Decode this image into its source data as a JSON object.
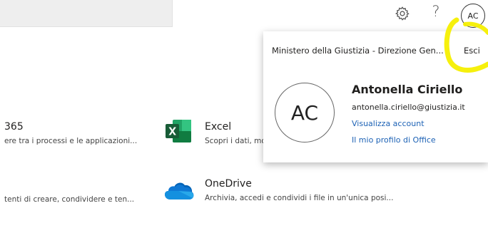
{
  "topbar": {
    "help_glyph": "?",
    "user_initials": "AC"
  },
  "apps": [
    {
      "name": "365",
      "description": "ere tra i processi e le applicazioni..."
    },
    {
      "name": "",
      "description": "tenti di creare, condividere e ten..."
    },
    {
      "name": "Excel",
      "description": "Scopri i dati, mo"
    },
    {
      "name": "OneDrive",
      "description": "Archivia, accedi e condividi i file in un'unica posi..."
    }
  ],
  "account_panel": {
    "organization": "Ministero della Giustizia - Direzione Gen...",
    "sign_out_label": "Esci",
    "initials": "AC",
    "user_name": "Antonella Ciriello",
    "user_email": "antonella.ciriello@giustizia.it",
    "view_account_label": "Visualizza account",
    "office_profile_label": "Il mio profilo di Office"
  },
  "icons": {
    "settings": "gear-icon",
    "excel": "excel-icon",
    "onedrive": "onedrive-icon"
  },
  "colors": {
    "link": "#1d62b5",
    "excel_green": "#1d6f42",
    "onedrive_blue": "#0364b8",
    "highlighter": "#f5ef00"
  }
}
